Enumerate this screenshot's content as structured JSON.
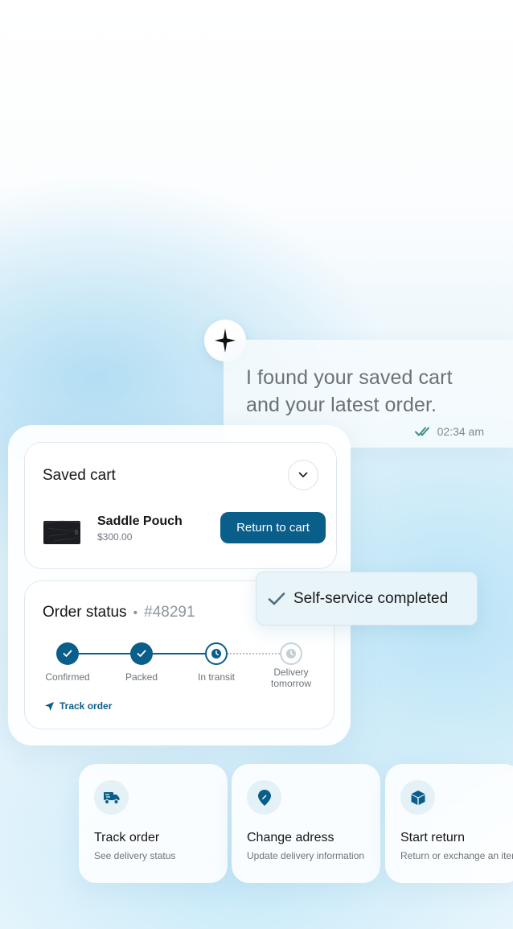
{
  "assistant": {
    "avatar_icon": "sparkle-icon",
    "message": "I found your saved cart and your latest order.",
    "time": "02:34 am",
    "status_icon": "double-check-icon"
  },
  "saved_cart": {
    "title": "Saved cart",
    "toggle_icon": "chevron-down-icon",
    "item": {
      "name": "Saddle Pouch",
      "price": "$300.00"
    },
    "return_button": "Return to cart"
  },
  "order_status": {
    "title": "Order status",
    "separator": "•",
    "order_number": "#48291",
    "steps": [
      {
        "label": "Confirmed",
        "state": "done"
      },
      {
        "label": "Packed",
        "state": "done"
      },
      {
        "label": "In transit",
        "state": "current"
      },
      {
        "label": "Delivery tomorrow",
        "state": "future"
      }
    ],
    "track_link": "Track order"
  },
  "badge": {
    "text": "Self-service completed",
    "icon": "check-icon"
  },
  "actions": [
    {
      "title": "Track order",
      "subtitle": "See delivery status",
      "icon": "truck-icon"
    },
    {
      "title": "Change adress",
      "subtitle": "Update delivery information",
      "icon": "location-pin-icon"
    },
    {
      "title": "Start return",
      "subtitle": "Return or exchange an item",
      "icon": "box-icon"
    }
  ],
  "colors": {
    "accent": "#0a5e8a",
    "check": "#3f8f8a"
  }
}
